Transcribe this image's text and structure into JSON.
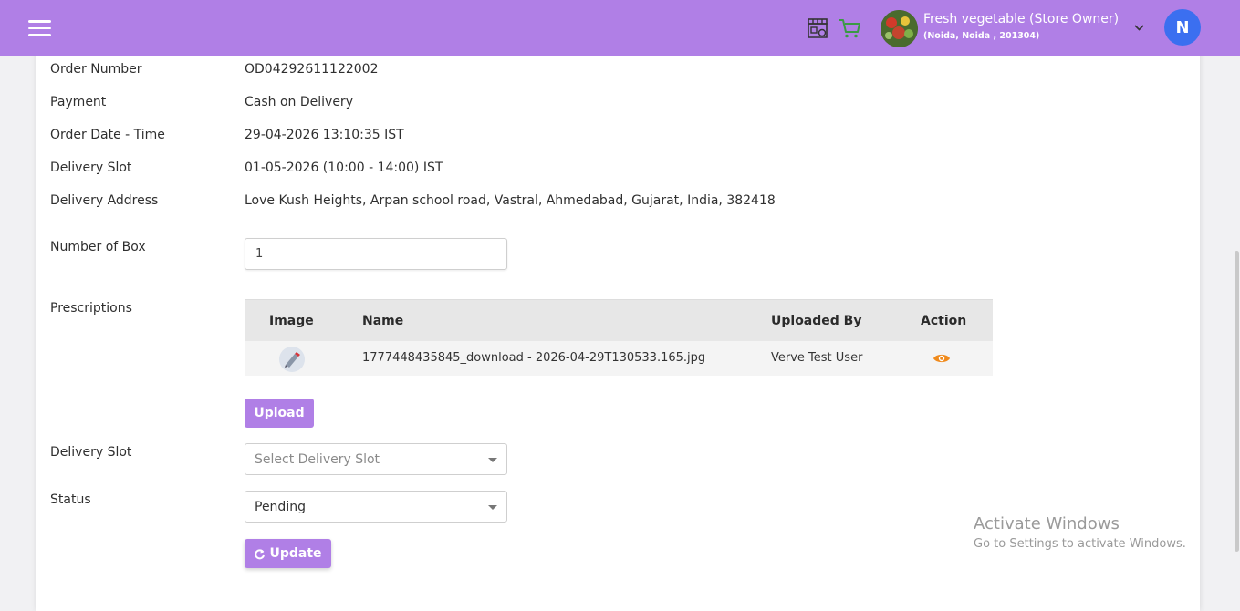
{
  "header": {
    "store_name": "Fresh vegetable (Store Owner)",
    "store_location": "(Noida, Noida , 201304)",
    "user_initial": "N",
    "accent_color": "#b07fe6"
  },
  "details": {
    "order_number_label": "Order Number",
    "order_number": "OD04292611122002",
    "payment_label": "Payment",
    "payment": "Cash on Delivery",
    "order_date_label": "Order Date - Time",
    "order_date": "29-04-2026 13:10:35 IST",
    "delivery_slot_label": "Delivery Slot",
    "delivery_slot": "01-05-2026 (10:00 - 14:00) IST",
    "delivery_address_label": "Delivery Address",
    "delivery_address": "Love Kush Heights, Arpan school road, Vastral, Ahmedabad, Gujarat, India, 382418"
  },
  "form": {
    "number_of_box_label": "Number of Box",
    "number_of_box_value": "1",
    "prescriptions_label": "Prescriptions",
    "upload_label": "Upload",
    "delivery_slot_select_label": "Delivery Slot",
    "delivery_slot_placeholder": "Select Delivery Slot",
    "status_label": "Status",
    "status_value": "Pending",
    "update_label": "Update"
  },
  "prescriptions_table": {
    "columns": [
      "Image",
      "Name",
      "Uploaded By",
      "Action"
    ],
    "rows": [
      {
        "name": "1777448435845_download - 2026-04-29T130533.165.jpg",
        "uploaded_by": "Verve Test User"
      }
    ]
  },
  "watermark": {
    "line1": "Activate Windows",
    "line2": "Go to Settings to activate Windows."
  }
}
